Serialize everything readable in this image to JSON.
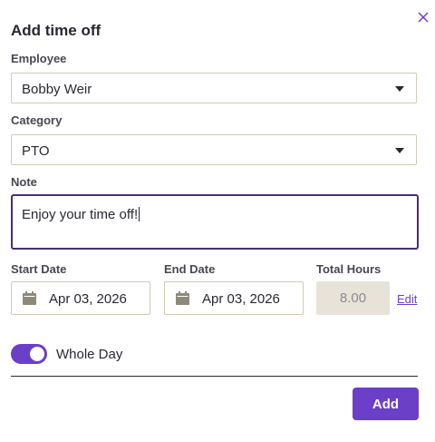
{
  "modal": {
    "title": "Add time off",
    "close_icon": "close-icon"
  },
  "employee": {
    "label": "Employee",
    "value": "Bobby Weir"
  },
  "category": {
    "label": "Category",
    "value": "PTO"
  },
  "note": {
    "label": "Note",
    "value": "Enjoy your time off!"
  },
  "start_date": {
    "label": "Start Date",
    "value": "Apr 03, 2026",
    "icon": "calendar-icon"
  },
  "end_date": {
    "label": "End Date",
    "value": "Apr 03, 2026",
    "icon": "calendar-icon"
  },
  "total_hours": {
    "label": "Total Hours",
    "value": "8.00",
    "edit_label": "Edit"
  },
  "whole_day": {
    "label": "Whole Day",
    "enabled": true
  },
  "actions": {
    "add_label": "Add"
  },
  "colors": {
    "accent": "#6b3fc7",
    "note_border": "#4a2a7a",
    "input_border": "#cfcbb5",
    "disabled_bg": "#e7e3d8"
  }
}
